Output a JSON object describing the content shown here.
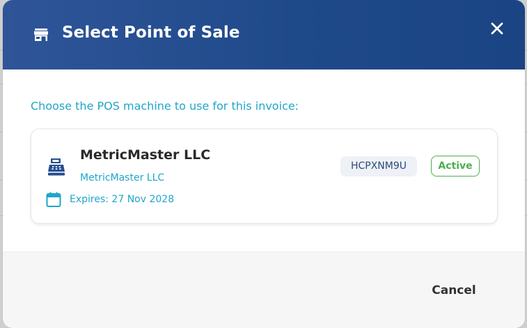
{
  "dialog": {
    "title": "Select Point of Sale",
    "title_icon": "store-icon",
    "close_icon": "close-icon"
  },
  "body": {
    "prompt": "Choose the POS machine to use for this invoice:",
    "pos_machines": [
      {
        "name": "MetricMaster LLC",
        "company": "MetricMaster LLC",
        "expiry": "Expires: 27 Nov 2028",
        "code": "HCPXNM9U",
        "status": "Active",
        "icon": "cash-register-icon",
        "expiry_icon": "calendar-icon"
      }
    ]
  },
  "footer": {
    "cancel_label": "Cancel"
  },
  "colors": {
    "header_bg": "#1f4a8a",
    "accent": "#1fa6c9",
    "status_active": "#4caf50",
    "code_badge_bg": "#eef1f6"
  }
}
